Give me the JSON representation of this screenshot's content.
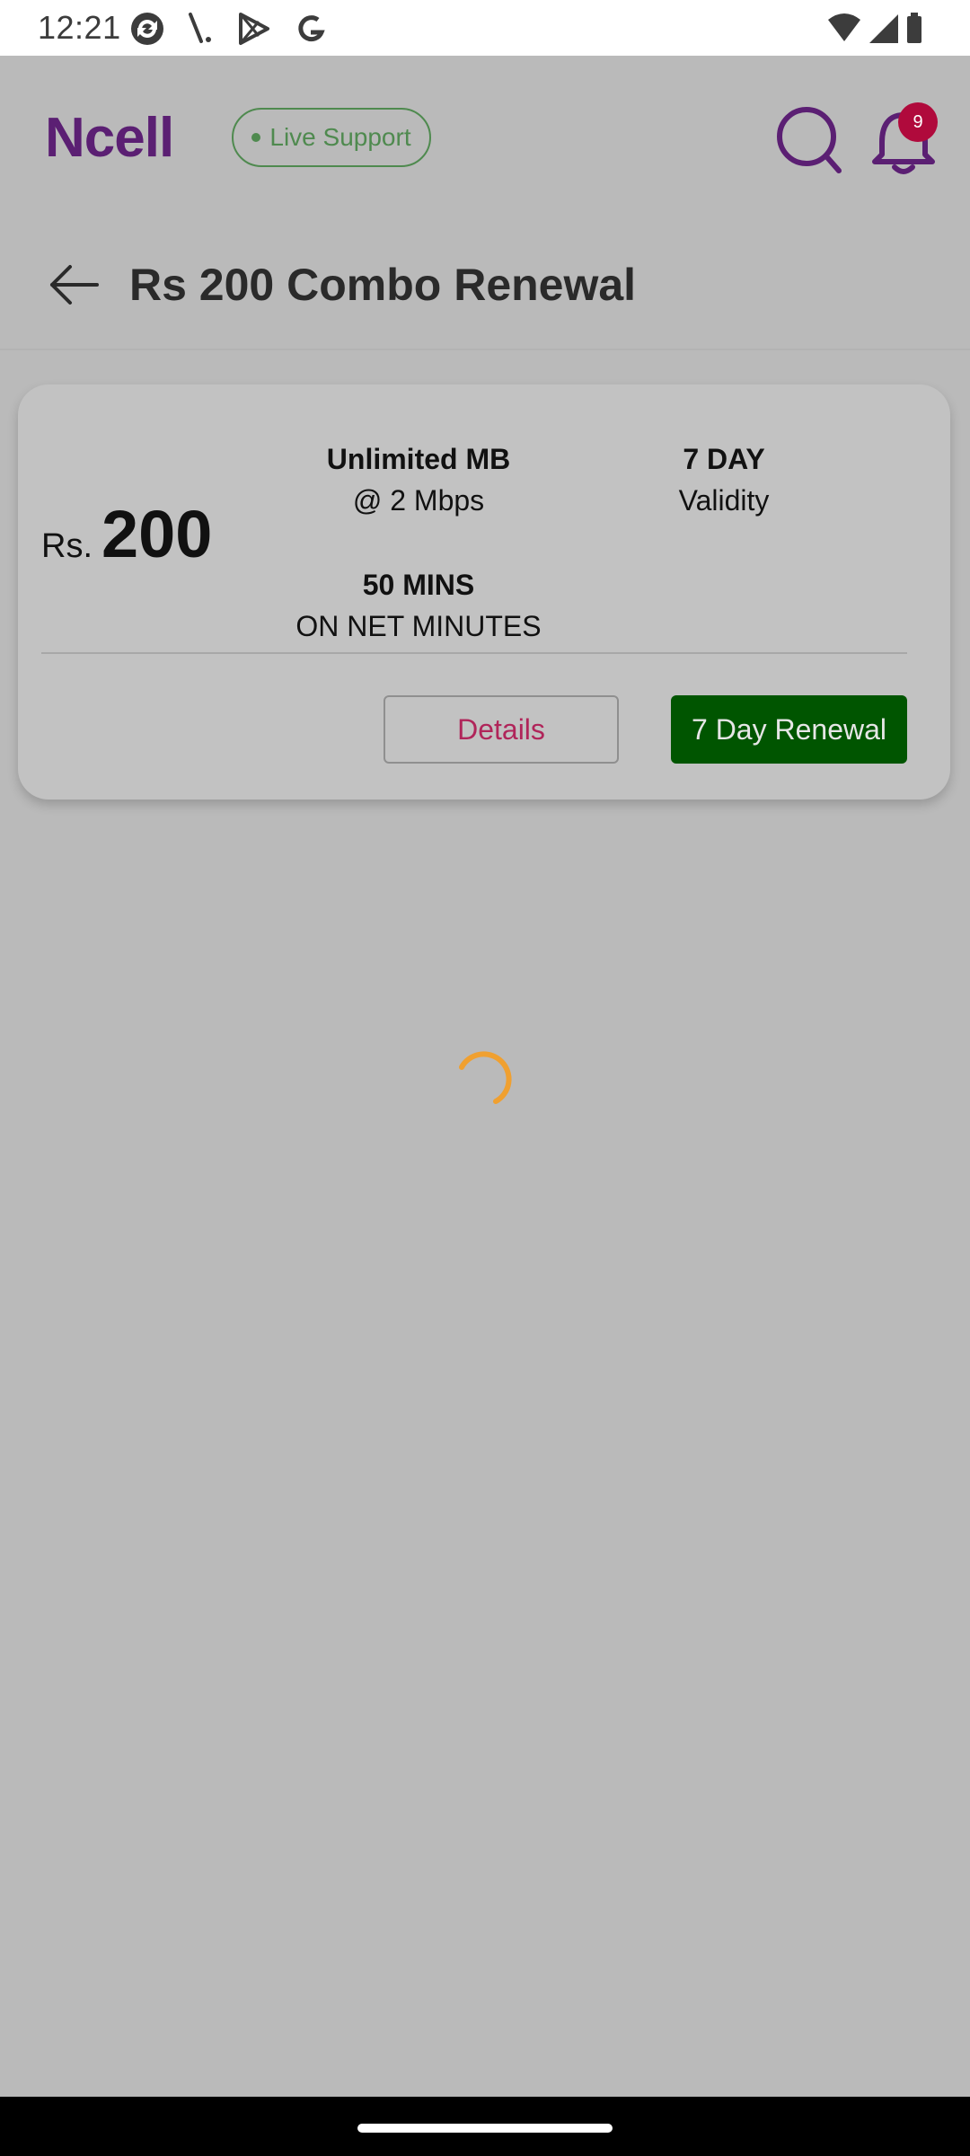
{
  "status_bar": {
    "time": "12:21",
    "left_icons": [
      "sync-icon",
      "signal-slash-icon",
      "play-store-icon",
      "google-icon"
    ],
    "right_icons": [
      "wifi-icon",
      "cell-signal-icon",
      "battery-icon"
    ]
  },
  "header": {
    "logo": "Ncell",
    "live_support": "Live Support",
    "notification_count": "9",
    "title": "Rs 200 Combo Renewal"
  },
  "package": {
    "currency": "Rs.",
    "price": "200",
    "data_amount": "Unlimited MB",
    "data_speed": "@ 2 Mbps",
    "validity_amount": "7 DAY",
    "validity_label": "Validity",
    "voice_amount": "50 MINS",
    "voice_label": "ON NET MINUTES",
    "details_label": "Details",
    "renew_label": "7 Day Renewal"
  },
  "colors": {
    "brand_purple": "#5b1f73",
    "live_green": "#4f8a4f",
    "badge_red": "#b00a3c",
    "renew_green": "#005500",
    "details_text": "#b0255a",
    "spinner": "#f0a030"
  }
}
